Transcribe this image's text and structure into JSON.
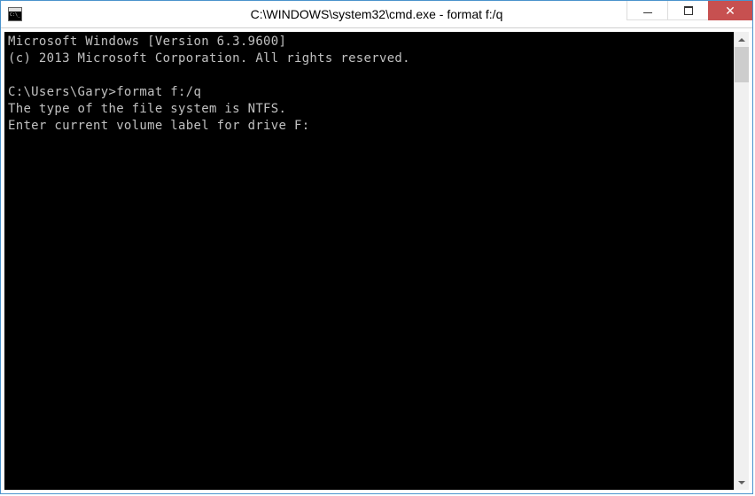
{
  "window": {
    "title": "C:\\WINDOWS\\system32\\cmd.exe - format  f:/q"
  },
  "terminal": {
    "lines": {
      "l0": "Microsoft Windows [Version 6.3.9600]",
      "l1": "(c) 2013 Microsoft Corporation. All rights reserved.",
      "l2": "",
      "l3_prompt": "C:\\Users\\Gary>",
      "l3_cmd": "format f:/q",
      "l4": "The type of the file system is NTFS.",
      "l5": "Enter current volume label for drive F:"
    }
  },
  "controls": {
    "close_glyph": "✕"
  }
}
